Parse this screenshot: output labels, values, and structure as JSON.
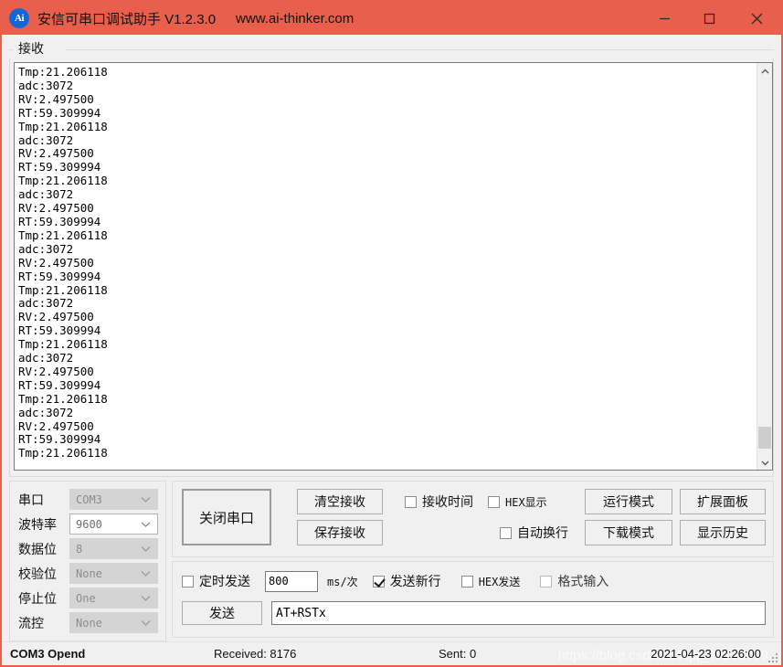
{
  "titlebar": {
    "icon": "app-ai-icon",
    "icon_text": "Ai",
    "title": "安信可串口调试助手 V1.2.3.0",
    "url": "www.ai-thinker.com",
    "minimize": "minimize-icon",
    "maximize": "maximize-icon",
    "close": "close-icon"
  },
  "receive": {
    "legend": "接收",
    "text": "Tmp:21.206118\nadc:3072\nRV:2.497500\nRT:59.309994\nTmp:21.206118\nadc:3072\nRV:2.497500\nRT:59.309994\nTmp:21.206118\nadc:3072\nRV:2.497500\nRT:59.309994\nTmp:21.206118\nadc:3072\nRV:2.497500\nRT:59.309994\nTmp:21.206118\nadc:3072\nRV:2.497500\nRT:59.309994\nTmp:21.206118\nadc:3072\nRV:2.497500\nRT:59.309994\nTmp:21.206118\nadc:3072\nRV:2.497500\nRT:59.309994\nTmp:21.206118",
    "scrollbar": {
      "up": "chevron-up-icon",
      "down": "chevron-down-icon"
    }
  },
  "serial_settings": {
    "rows": [
      {
        "label": "串口",
        "value": "COM3",
        "enabled": false
      },
      {
        "label": "波特率",
        "value": "9600",
        "enabled": true
      },
      {
        "label": "数据位",
        "value": "8",
        "enabled": false
      },
      {
        "label": "校验位",
        "value": "None",
        "enabled": false
      },
      {
        "label": "停止位",
        "value": "One",
        "enabled": false
      },
      {
        "label": "流控",
        "value": "None",
        "enabled": false
      }
    ]
  },
  "controls": {
    "close_serial": "关闭串口",
    "clear_receive": "清空接收",
    "save_receive": "保存接收",
    "checkbox_recv_time": {
      "label": "接收时间",
      "checked": false
    },
    "checkbox_hex_display": {
      "label": "HEX显示",
      "checked": false
    },
    "checkbox_auto_wrap": {
      "label": "自动换行",
      "checked": false
    },
    "run_mode": "运行模式",
    "download_mode": "下载模式",
    "expand_panel": "扩展面板",
    "show_history": "显示历史"
  },
  "send": {
    "checkbox_timed_send": {
      "label": "定时发送",
      "checked": false
    },
    "interval_value": "800",
    "interval_unit": "ms/次",
    "checkbox_send_newline": {
      "label": "发送新行",
      "checked": true
    },
    "checkbox_hex_send": {
      "label": "HEX发送",
      "checked": false
    },
    "checkbox_format_input": {
      "label": "格式输入",
      "checked": false
    },
    "send_button": "发送",
    "input_value": "AT+RSTx",
    "input_placeholder": ""
  },
  "statusbar": {
    "connection": "COM3 Opend",
    "received": "Received: 8176",
    "sent": "Sent: 0",
    "datetime": "2021-04-23 02:26:00",
    "watermark": "https://blog.csdn.net/qq_40262079"
  },
  "colors": {
    "accent": "#e8604c",
    "window_bg": "#f0f0f0",
    "text_bg": "#ffffff",
    "icon_blue": "#1565d8"
  }
}
